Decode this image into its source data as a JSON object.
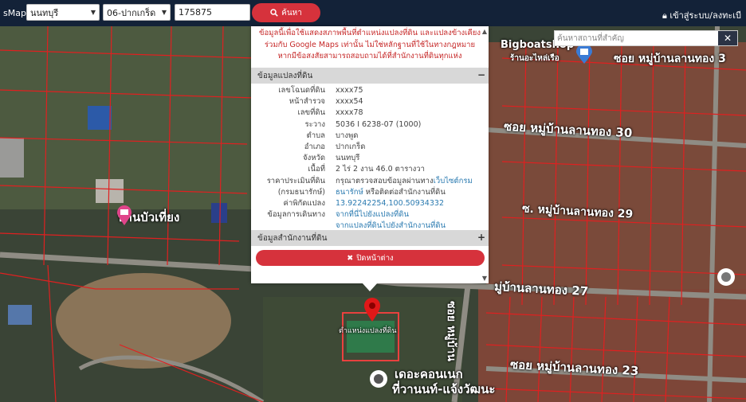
{
  "topbar": {
    "brand": "sMaps",
    "province": "นนทบุรี",
    "district": "06-ปากเกร็ด",
    "deed_number": "175875",
    "search_label": "ค้นหา",
    "login_label": "เข้าสู่ระบบ/ลงทะเบี"
  },
  "place_search": {
    "placeholder": "ค้นหาสถานที่สำคัญ",
    "clear_label": "✕"
  },
  "panel": {
    "disclaimer": "ข้อมูลนี้เพื่อใช้แสดงสภาพพื้นที่ตำแหน่งแปลงที่ดิน และแปลงข้างเคียงร่วมกับ Google Maps เท่านั้น ไม่ใช่หลักฐานที่ใช้ในทางกฎหมาย หากมีข้อสงสัยสามารถสอบถามได้ที่สำนักงานที่ดินทุกแห่ง",
    "parcel_header": "ข้อมูลแปลงที่ดิน",
    "parcel_toggle": "−",
    "rows": [
      {
        "label": "เลขโฉนดที่ดิน",
        "value": "xxxx75"
      },
      {
        "label": "หน้าสำรวจ",
        "value": "xxxx54"
      },
      {
        "label": "เลขที่ดิน",
        "value": "xxxx78"
      },
      {
        "label": "ระวาง",
        "value": "5036 I 6238-07 (1000)"
      },
      {
        "label": "ตำบล",
        "value": "บางพูด"
      },
      {
        "label": "อำเภอ",
        "value": "ปากเกร็ด"
      },
      {
        "label": "จังหวัด",
        "value": "นนทบุรี"
      },
      {
        "label": "เนื้อที่",
        "value": "2 ไร่ 2 งาน 46.0 ตารางวา"
      },
      {
        "label": "ราคาประเมินที่ดิน",
        "value": "กรุณาตรวจสอบข้อมูลผ่านทาง",
        "link": "เว็บไซต์กรม"
      },
      {
        "label": "(กรมธนารักษ์)",
        "value": "",
        "link": "ธนารักษ์",
        "tail": " หรือติดต่อสำนักงานที่ดิน"
      },
      {
        "label": "ค่าพิกัดแปลง",
        "value": "",
        "link": "13.92242254,100.50934332"
      },
      {
        "label": "ข้อมูลการเดินทาง",
        "value": "",
        "link": "จากที่นี่ไปยังแปลงที่ดิน"
      },
      {
        "label": "",
        "value": "",
        "link": "จากแปลงที่ดินไปยังสำนักงานที่ดิน"
      }
    ],
    "office_header": "ข้อมูลสำนักงานที่ดิน",
    "office_toggle": "+",
    "close_label": "ปิดหน้าต่าง"
  },
  "map_labels": {
    "home": "บ้านบัวเที่ยง",
    "parcel_marker": "ตำแหน่งแปลงที่ดิน",
    "shop": "Bigboatshop",
    "shop_sub": "ร้านอะไหล่เรือ",
    "soi_top": "ซอย หมู่บ้านลานทอง 3",
    "soi_30": "ซอย หมู่บ้านลานทอง 30",
    "soi_29": "ซ. หมู่บ้านลานทอง 29",
    "soi_27": "มู่บ้านลานทอง 27",
    "soi_23": "ซอย หมู่บ้านลานทอง 23",
    "soi_vertical": "ซอย หมู่บ้าน",
    "condo": "เดอะคอนเนก",
    "condo_sub": "ที่วานนท์-แจ้งวัฒนะ"
  },
  "colors": {
    "topbar": "#132238",
    "accent": "#d6323c",
    "parcel_line": "#e02020",
    "link": "#2a7ab0"
  }
}
